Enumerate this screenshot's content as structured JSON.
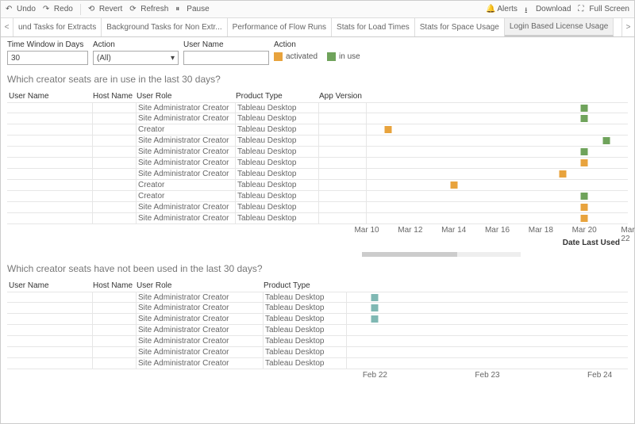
{
  "toolbar": {
    "undo": "Undo",
    "redo": "Redo",
    "revert": "Revert",
    "refresh": "Refresh",
    "pause": "Pause",
    "alerts": "Alerts",
    "download": "Download",
    "fullscreen": "Full Screen"
  },
  "tabs": {
    "items": [
      "und Tasks for Extracts",
      "Background Tasks for Non Extr...",
      "Performance of Flow Runs",
      "Stats for Load Times",
      "Stats for Space Usage",
      "Login Based License Usage"
    ],
    "active_index": 5
  },
  "filters": {
    "time_window_label": "Time Window in Days",
    "time_window_value": "30",
    "action_label": "Action",
    "action_value": "(All)",
    "user_label": "User Name",
    "user_value": "",
    "legend_label": "Action",
    "legend_items": [
      "activated",
      "in use"
    ]
  },
  "section1": {
    "title": "Which creator seats are in use in the last 30 days?",
    "headers": {
      "user": "User Name",
      "host": "Host Name",
      "role": "User Role",
      "product": "Product Type",
      "app": "App Version"
    },
    "axis_title": "Date Last Used"
  },
  "section2": {
    "title": "Which creator seats have not been used in the last 30 days?",
    "headers": {
      "user": "User Name",
      "host": "Host Name",
      "role": "User Role",
      "product": "Product Type"
    }
  },
  "chart_data": [
    {
      "type": "scatter",
      "title": "Which creator seats are in use in the last 30 days?",
      "x_axis": {
        "label": "Date Last Used",
        "ticks": [
          "Mar 10",
          "Mar 12",
          "Mar 14",
          "Mar 16",
          "Mar 18",
          "Mar 20",
          "Mar 22"
        ]
      },
      "legend": {
        "activated": "#e8a33d",
        "in use": "#6fa35b"
      },
      "rows": [
        {
          "role": "Site Administrator Creator",
          "product": "Tableau Desktop",
          "date": "Mar 20",
          "status": "in use"
        },
        {
          "role": "Site Administrator Creator",
          "product": "Tableau Desktop",
          "date": "Mar 20",
          "status": "in use"
        },
        {
          "role": "Creator",
          "product": "Tableau Desktop",
          "date": "Mar 11",
          "status": "activated"
        },
        {
          "role": "Site Administrator Creator",
          "product": "Tableau Desktop",
          "date": "Mar 21",
          "status": "in use"
        },
        {
          "role": "Site Administrator Creator",
          "product": "Tableau Desktop",
          "date": "Mar 20",
          "status": "in use"
        },
        {
          "role": "Site Administrator Creator",
          "product": "Tableau Desktop",
          "date": "Mar 20",
          "status": "activated"
        },
        {
          "role": "Site Administrator Creator",
          "product": "Tableau Desktop",
          "date": "Mar 19",
          "status": "activated"
        },
        {
          "role": "Creator",
          "product": "Tableau Desktop",
          "date": "Mar 14",
          "status": "activated"
        },
        {
          "role": "Creator",
          "product": "Tableau Desktop",
          "date": "Mar 20",
          "status": "in use"
        },
        {
          "role": "Site Administrator Creator",
          "product": "Tableau Desktop",
          "date": "Mar 20",
          "status": "activated"
        },
        {
          "role": "Site Administrator Creator",
          "product": "Tableau Desktop",
          "date": "Mar 20",
          "status": "activated"
        }
      ]
    },
    {
      "type": "scatter",
      "title": "Which creator seats have not been used in the last 30 days?",
      "x_axis": {
        "ticks": [
          "Feb 22",
          "Feb 23",
          "Feb 24"
        ]
      },
      "rows": [
        {
          "role": "Site Administrator Creator",
          "product": "Tableau Desktop",
          "date": "Feb 22",
          "status": "unused"
        },
        {
          "role": "Site Administrator Creator",
          "product": "Tableau Desktop",
          "date": "Feb 22",
          "status": "unused"
        },
        {
          "role": "Site Administrator Creator",
          "product": "Tableau Desktop",
          "date": "Feb 22",
          "status": "unused"
        },
        {
          "role": "Site Administrator Creator",
          "product": "Tableau Desktop",
          "date": null,
          "status": null
        },
        {
          "role": "Site Administrator Creator",
          "product": "Tableau Desktop",
          "date": null,
          "status": null
        },
        {
          "role": "Site Administrator Creator",
          "product": "Tableau Desktop",
          "date": null,
          "status": null
        },
        {
          "role": "Site Administrator Creator",
          "product": "Tableau Desktop",
          "date": null,
          "status": null
        }
      ]
    }
  ],
  "colors": {
    "activated": "#e8a33d",
    "in use": "#6fa35b",
    "unused": "#7fb8b3"
  }
}
